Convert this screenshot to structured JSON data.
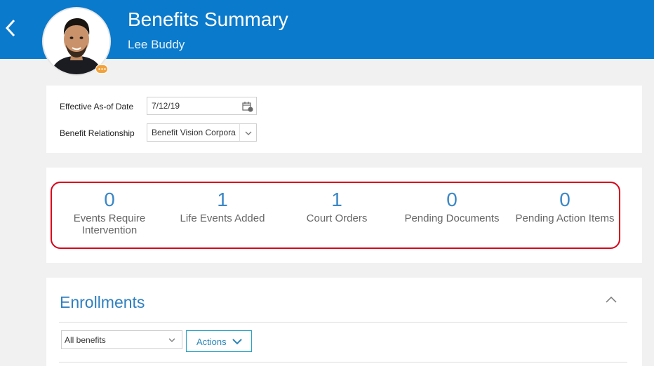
{
  "header": {
    "title": "Benefits Summary",
    "subtitle": "Lee Buddy",
    "background": "#0a7acc"
  },
  "filters": {
    "effective_date_label": "Effective As-of Date",
    "effective_date_value": "7/12/19",
    "relationship_label": "Benefit Relationship",
    "relationship_value": "Benefit Vision Corpora"
  },
  "summary": {
    "highlight_color": "#d8001a",
    "metrics": [
      {
        "value": "0",
        "label": "Events Require Intervention"
      },
      {
        "value": "1",
        "label": "Life Events Added"
      },
      {
        "value": "1",
        "label": "Court Orders"
      },
      {
        "value": "0",
        "label": "Pending Documents"
      },
      {
        "value": "0",
        "label": "Pending Action Items"
      }
    ]
  },
  "enrollments": {
    "title": "Enrollments",
    "filter_value": "All benefits",
    "actions_label": "Actions"
  },
  "icons": {
    "back": "back-arrow-icon",
    "calendar": "calendar-icon",
    "chevron": "chevron-down-icon",
    "collapse": "chevron-up-icon",
    "avatar": "avatar",
    "status": "status-badge"
  }
}
